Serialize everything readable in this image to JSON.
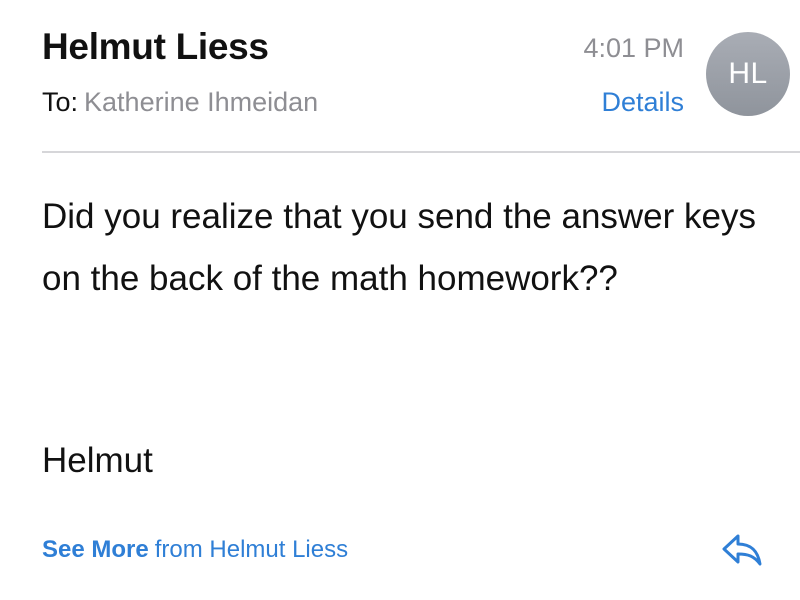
{
  "header": {
    "sender_name": "Helmut Liess",
    "to_label": "To:",
    "recipient": "Katherine Ihmeidan",
    "time": "4:01 PM",
    "details_link": "Details",
    "avatar_initials": "HL"
  },
  "message": {
    "body": "Did you realize that you send the answer keys on the back of the math homework??",
    "signature": "Helmut"
  },
  "footer": {
    "see_more_label": "See More",
    "see_more_suffix": "from Helmut Liess",
    "reply_icon": "reply-arrow"
  },
  "colors": {
    "link_blue": "#2f7fd6",
    "secondary_gray": "#8e8e93",
    "avatar_gray": "#9a9ea6",
    "divider": "#d6d6d9"
  }
}
